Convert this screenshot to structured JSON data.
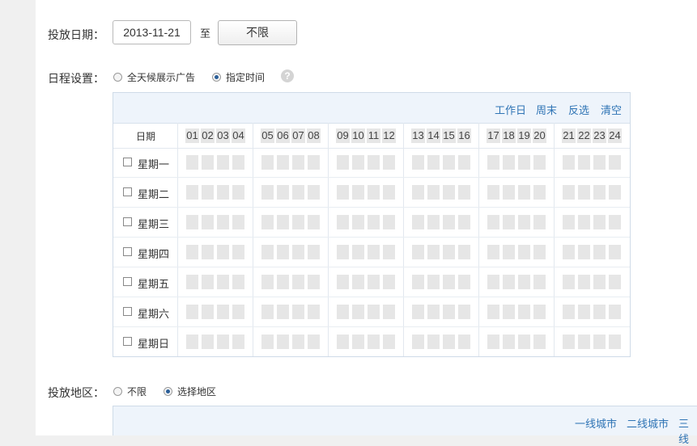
{
  "form": {
    "date_label": "投放日期：",
    "start_date": "2013-11-21",
    "to_text": "至",
    "end_button": "不限",
    "schedule_label": "日程设置：",
    "schedule_option_all": "全天候展示广告",
    "schedule_option_specific": "指定时间",
    "help_glyph": "?",
    "region_label": "投放地区：",
    "region_option_all": "不限",
    "region_option_select": "选择地区"
  },
  "schedule": {
    "toolbar": [
      "工作日",
      "周末",
      "反选",
      "清空"
    ],
    "date_header": "日期",
    "hours": [
      "01",
      "02",
      "03",
      "04",
      "05",
      "06",
      "07",
      "08",
      "09",
      "10",
      "11",
      "12",
      "13",
      "14",
      "15",
      "16",
      "17",
      "18",
      "19",
      "20",
      "21",
      "22",
      "23",
      "24"
    ],
    "days": [
      "星期一",
      "星期二",
      "星期三",
      "星期四",
      "星期五",
      "星期六",
      "星期日"
    ]
  },
  "region": {
    "links": [
      "一线城市",
      "二线城市",
      "三线"
    ]
  },
  "colors": {
    "link": "#2f74b5",
    "toolbar_bg": "#eef4fb",
    "cell": "#e6e6e6",
    "radio_checked": "#2a5e98"
  }
}
